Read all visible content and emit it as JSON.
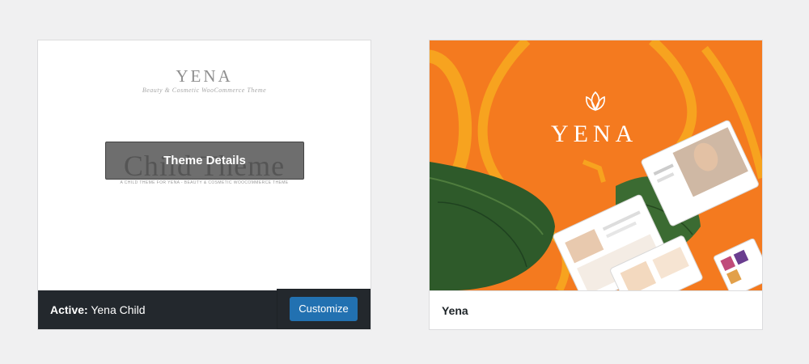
{
  "active_theme": {
    "screenshot": {
      "logo": "YENA",
      "tagline": "Beauty & Cosmetic WooCommerce Theme",
      "heading": "Child Theme",
      "subtext": "A CHILD THEME FOR YENA - BEAUTY & COSMETIC WOOCOMMERCE THEME"
    },
    "details_button": "Theme Details",
    "status_label": "Active:",
    "name": "Yena Child",
    "customize_button": "Customize"
  },
  "parent_theme": {
    "screenshot": {
      "logo": "YENA"
    },
    "name": "Yena"
  },
  "colors": {
    "page_bg": "#f0f0f1",
    "active_footer": "#23282d",
    "primary_button": "#2271b1",
    "yena_orange": "#f47a1f",
    "leaf_green": "#2e5a2a"
  }
}
